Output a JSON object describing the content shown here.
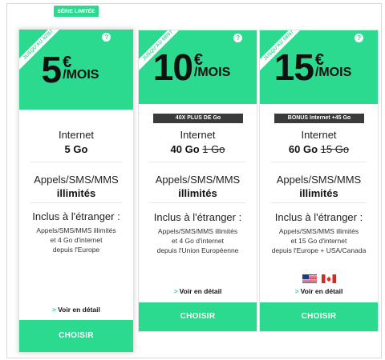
{
  "colors": {
    "accent": "#2bd98f",
    "badge_bg": "#3a3a3a"
  },
  "plans": [
    {
      "ribbon": "JUSQU'AU 02/07",
      "tag": "SÉRIE LIMITÉE",
      "price": "5",
      "currency": "€",
      "period": "/MOIS",
      "help": "?",
      "badge": "",
      "internet_label": "Internet",
      "data_value": "5 Go",
      "data_old": "",
      "calls_label": "Appels/SMS/MMS",
      "calls_value": "illimités",
      "abroad_label": "Inclus à l'étranger :",
      "abroad_line1": "Appels/SMS/MMS illimités",
      "abroad_line2": "et 4 Go d'internet",
      "abroad_line3": "depuis l'Europe",
      "detail_arrow": ">",
      "detail_label": "Voir en détail",
      "button": "CHOISIR"
    },
    {
      "ribbon": "JUSQU'AU 08/07",
      "price": "10",
      "currency": "€",
      "period": "/MOIS",
      "help": "?",
      "badge": "40X PLUS DE Go",
      "internet_label": "Internet",
      "data_value": "40 Go",
      "data_old": "1 Go",
      "calls_label": "Appels/SMS/MMS",
      "calls_value": "illimités",
      "abroad_label": "Inclus à l'étranger :",
      "abroad_line1": "Appels/SMS/MMS illimités",
      "abroad_line2": "et 4 Go d'internet",
      "abroad_line3": "depuis l'Union Européenne",
      "detail_arrow": ">",
      "detail_label": "Voir en détail",
      "button": "CHOISIR"
    },
    {
      "ribbon": "JUSQU'AU 08/07",
      "price": "15",
      "currency": "€",
      "period": "/MOIS",
      "help": "?",
      "badge": "BONUS Internet +45 Go",
      "internet_label": "Internet",
      "data_value": "60 Go",
      "data_old": "15 Go",
      "calls_label": "Appels/SMS/MMS",
      "calls_value": "illimités",
      "abroad_label": "Inclus à l'étranger :",
      "abroad_line1": "Appels/SMS/MMS illimités",
      "abroad_line2": "et 15 Go d'internet",
      "abroad_line3": "depuis l'Europe + USA/Canada",
      "flags": [
        "usa-flag-icon",
        "canada-flag-icon"
      ],
      "detail_arrow": ">",
      "detail_label": "Voir en détail",
      "button": "CHOISIR"
    }
  ]
}
